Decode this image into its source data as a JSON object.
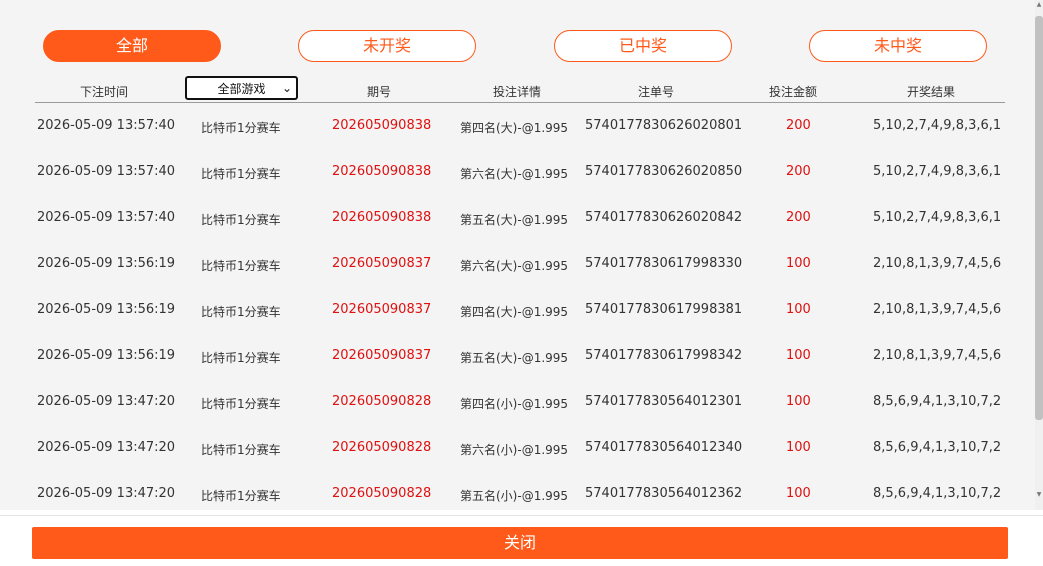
{
  "tabs": [
    {
      "label": "全部",
      "active": true
    },
    {
      "label": "未开奖",
      "active": false
    },
    {
      "label": "已中奖",
      "active": false
    },
    {
      "label": "未中奖",
      "active": false
    }
  ],
  "columns": {
    "time": "下注时间",
    "game": "全部游戏",
    "period": "期号",
    "detail": "投注详情",
    "order": "注单号",
    "amount": "投注金额",
    "result": "开奖结果"
  },
  "rows": [
    {
      "time": "2026-05-09 13:57:40",
      "game": "比特币1分赛车",
      "period": "202605090838",
      "detail": "第四名(大)-@1.995",
      "order": "5740177830626020801",
      "amount": "200",
      "result": "5,10,2,7,4,9,8,3,6,1"
    },
    {
      "time": "2026-05-09 13:57:40",
      "game": "比特币1分赛车",
      "period": "202605090838",
      "detail": "第六名(大)-@1.995",
      "order": "5740177830626020850",
      "amount": "200",
      "result": "5,10,2,7,4,9,8,3,6,1"
    },
    {
      "time": "2026-05-09 13:57:40",
      "game": "比特币1分赛车",
      "period": "202605090838",
      "detail": "第五名(大)-@1.995",
      "order": "5740177830626020842",
      "amount": "200",
      "result": "5,10,2,7,4,9,8,3,6,1"
    },
    {
      "time": "2026-05-09 13:56:19",
      "game": "比特币1分赛车",
      "period": "202605090837",
      "detail": "第六名(大)-@1.995",
      "order": "5740177830617998330",
      "amount": "100",
      "result": "2,10,8,1,3,9,7,4,5,6"
    },
    {
      "time": "2026-05-09 13:56:19",
      "game": "比特币1分赛车",
      "period": "202605090837",
      "detail": "第四名(大)-@1.995",
      "order": "5740177830617998381",
      "amount": "100",
      "result": "2,10,8,1,3,9,7,4,5,6"
    },
    {
      "time": "2026-05-09 13:56:19",
      "game": "比特币1分赛车",
      "period": "202605090837",
      "detail": "第五名(大)-@1.995",
      "order": "5740177830617998342",
      "amount": "100",
      "result": "2,10,8,1,3,9,7,4,5,6"
    },
    {
      "time": "2026-05-09 13:47:20",
      "game": "比特币1分赛车",
      "period": "202605090828",
      "detail": "第四名(小)-@1.995",
      "order": "5740177830564012301",
      "amount": "100",
      "result": "8,5,6,9,4,1,3,10,7,2"
    },
    {
      "time": "2026-05-09 13:47:20",
      "game": "比特币1分赛车",
      "period": "202605090828",
      "detail": "第六名(小)-@1.995",
      "order": "5740177830564012340",
      "amount": "100",
      "result": "8,5,6,9,4,1,3,10,7,2"
    },
    {
      "time": "2026-05-09 13:47:20",
      "game": "比特币1分赛车",
      "period": "202605090828",
      "detail": "第五名(小)-@1.995",
      "order": "5740177830564012362",
      "amount": "100",
      "result": "8,5,6,9,4,1,3,10,7,2"
    }
  ],
  "footer": {
    "close_label": "关闭"
  },
  "colors": {
    "accent": "#ff5a1a",
    "highlight": "#e01010"
  }
}
